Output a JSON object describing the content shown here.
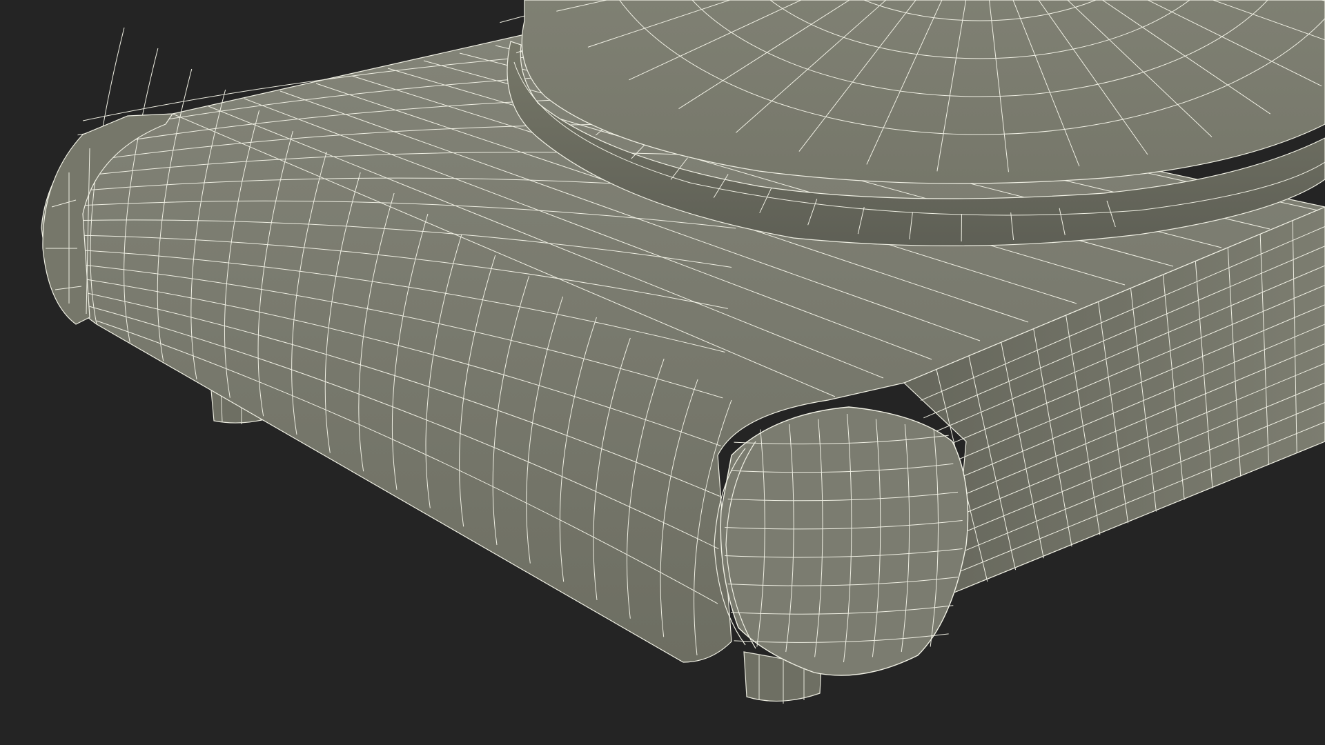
{
  "scene": {
    "background_color": "#242424",
    "surface_color": "#7a7b6d",
    "surface_shadow_color": "#5f6056",
    "surface_highlight_color": "#85867a",
    "wire_color": "#f2f2e8",
    "render_mode": "wireframe-on-shaded"
  }
}
